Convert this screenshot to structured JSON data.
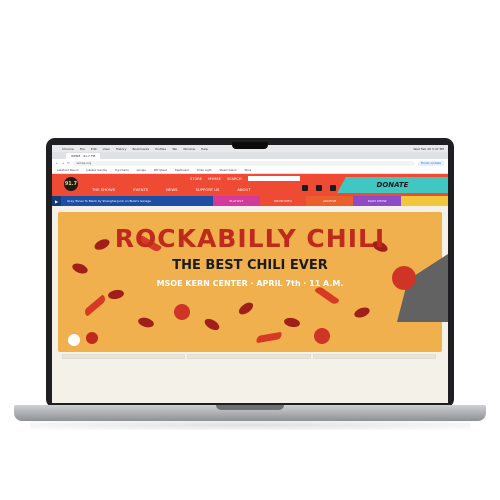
{
  "macos_menu": [
    "Chrome",
    "File",
    "Edit",
    "View",
    "History",
    "Bookmarks",
    "Profiles",
    "Tab",
    "Window",
    "Help"
  ],
  "macos_status": "Wed Feb 28 3:47 PM",
  "browser": {
    "tab_title": "WMSE · 91.7 FM",
    "url": "wmse.org",
    "update_label": "Finish update",
    "bookmarks": [
      "Lakefront Bound",
      "Jukebox Sunday",
      "Top Charts",
      "Google",
      "WD Sheet",
      "Dashboard",
      "Order Light",
      "Steam Island",
      "Store"
    ]
  },
  "site": {
    "logo_text": "91.7",
    "top_links": [
      "STORE",
      "MYMSE",
      "SEARCH"
    ],
    "main_nav": [
      "THE SHOWS",
      "EVENTS",
      "NEWS",
      "SUPPORT US",
      "ABOUT"
    ],
    "donate": "DONATE",
    "now_playing": "Grey Tones To Black by Shanghai Junk on Buzz's Garage",
    "playlist": "PLAYLIST",
    "show_info": "SHOW INFO",
    "archive": "ARCHIVE",
    "daily_show": "DAILY SHOW"
  },
  "hero": {
    "title": "ROCKABILLY CHILI",
    "subtitle": "THE BEST CHILI EVER",
    "details": "MSOE KERN CENTER · APRIL 7th · 11 A.M."
  },
  "colors": {
    "header_red": "#ef4a34",
    "player_blue": "#1e4ea3",
    "donate_teal": "#40c7c1",
    "hero_orange": "#f0b04e",
    "chili_red": "#c02a1d"
  }
}
